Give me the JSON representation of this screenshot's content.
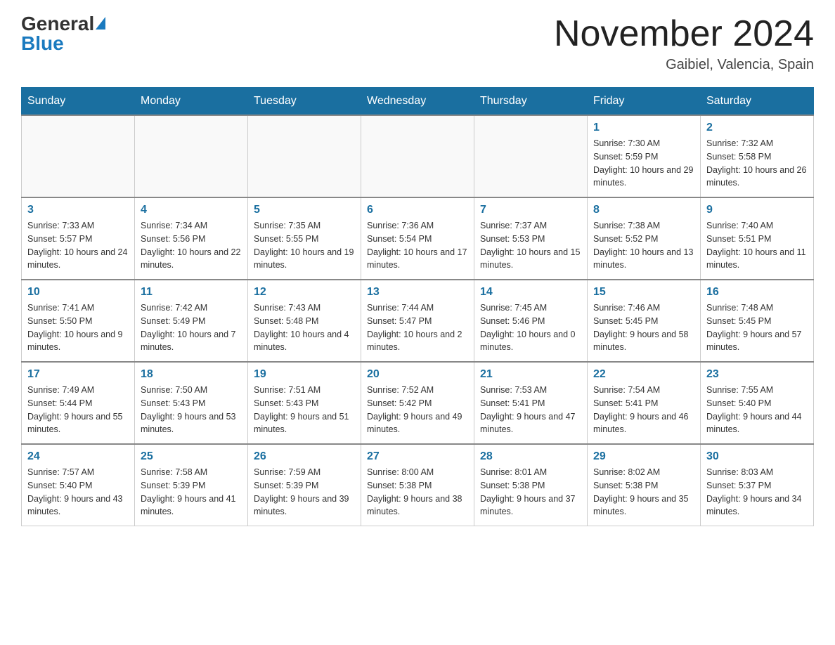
{
  "header": {
    "logo_general": "General",
    "logo_blue": "Blue",
    "month_title": "November 2024",
    "location": "Gaibiel, Valencia, Spain"
  },
  "days_of_week": [
    "Sunday",
    "Monday",
    "Tuesday",
    "Wednesday",
    "Thursday",
    "Friday",
    "Saturday"
  ],
  "weeks": [
    [
      {
        "day": "",
        "info": ""
      },
      {
        "day": "",
        "info": ""
      },
      {
        "day": "",
        "info": ""
      },
      {
        "day": "",
        "info": ""
      },
      {
        "day": "",
        "info": ""
      },
      {
        "day": "1",
        "info": "Sunrise: 7:30 AM\nSunset: 5:59 PM\nDaylight: 10 hours and 29 minutes."
      },
      {
        "day": "2",
        "info": "Sunrise: 7:32 AM\nSunset: 5:58 PM\nDaylight: 10 hours and 26 minutes."
      }
    ],
    [
      {
        "day": "3",
        "info": "Sunrise: 7:33 AM\nSunset: 5:57 PM\nDaylight: 10 hours and 24 minutes."
      },
      {
        "day": "4",
        "info": "Sunrise: 7:34 AM\nSunset: 5:56 PM\nDaylight: 10 hours and 22 minutes."
      },
      {
        "day": "5",
        "info": "Sunrise: 7:35 AM\nSunset: 5:55 PM\nDaylight: 10 hours and 19 minutes."
      },
      {
        "day": "6",
        "info": "Sunrise: 7:36 AM\nSunset: 5:54 PM\nDaylight: 10 hours and 17 minutes."
      },
      {
        "day": "7",
        "info": "Sunrise: 7:37 AM\nSunset: 5:53 PM\nDaylight: 10 hours and 15 minutes."
      },
      {
        "day": "8",
        "info": "Sunrise: 7:38 AM\nSunset: 5:52 PM\nDaylight: 10 hours and 13 minutes."
      },
      {
        "day": "9",
        "info": "Sunrise: 7:40 AM\nSunset: 5:51 PM\nDaylight: 10 hours and 11 minutes."
      }
    ],
    [
      {
        "day": "10",
        "info": "Sunrise: 7:41 AM\nSunset: 5:50 PM\nDaylight: 10 hours and 9 minutes."
      },
      {
        "day": "11",
        "info": "Sunrise: 7:42 AM\nSunset: 5:49 PM\nDaylight: 10 hours and 7 minutes."
      },
      {
        "day": "12",
        "info": "Sunrise: 7:43 AM\nSunset: 5:48 PM\nDaylight: 10 hours and 4 minutes."
      },
      {
        "day": "13",
        "info": "Sunrise: 7:44 AM\nSunset: 5:47 PM\nDaylight: 10 hours and 2 minutes."
      },
      {
        "day": "14",
        "info": "Sunrise: 7:45 AM\nSunset: 5:46 PM\nDaylight: 10 hours and 0 minutes."
      },
      {
        "day": "15",
        "info": "Sunrise: 7:46 AM\nSunset: 5:45 PM\nDaylight: 9 hours and 58 minutes."
      },
      {
        "day": "16",
        "info": "Sunrise: 7:48 AM\nSunset: 5:45 PM\nDaylight: 9 hours and 57 minutes."
      }
    ],
    [
      {
        "day": "17",
        "info": "Sunrise: 7:49 AM\nSunset: 5:44 PM\nDaylight: 9 hours and 55 minutes."
      },
      {
        "day": "18",
        "info": "Sunrise: 7:50 AM\nSunset: 5:43 PM\nDaylight: 9 hours and 53 minutes."
      },
      {
        "day": "19",
        "info": "Sunrise: 7:51 AM\nSunset: 5:43 PM\nDaylight: 9 hours and 51 minutes."
      },
      {
        "day": "20",
        "info": "Sunrise: 7:52 AM\nSunset: 5:42 PM\nDaylight: 9 hours and 49 minutes."
      },
      {
        "day": "21",
        "info": "Sunrise: 7:53 AM\nSunset: 5:41 PM\nDaylight: 9 hours and 47 minutes."
      },
      {
        "day": "22",
        "info": "Sunrise: 7:54 AM\nSunset: 5:41 PM\nDaylight: 9 hours and 46 minutes."
      },
      {
        "day": "23",
        "info": "Sunrise: 7:55 AM\nSunset: 5:40 PM\nDaylight: 9 hours and 44 minutes."
      }
    ],
    [
      {
        "day": "24",
        "info": "Sunrise: 7:57 AM\nSunset: 5:40 PM\nDaylight: 9 hours and 43 minutes."
      },
      {
        "day": "25",
        "info": "Sunrise: 7:58 AM\nSunset: 5:39 PM\nDaylight: 9 hours and 41 minutes."
      },
      {
        "day": "26",
        "info": "Sunrise: 7:59 AM\nSunset: 5:39 PM\nDaylight: 9 hours and 39 minutes."
      },
      {
        "day": "27",
        "info": "Sunrise: 8:00 AM\nSunset: 5:38 PM\nDaylight: 9 hours and 38 minutes."
      },
      {
        "day": "28",
        "info": "Sunrise: 8:01 AM\nSunset: 5:38 PM\nDaylight: 9 hours and 37 minutes."
      },
      {
        "day": "29",
        "info": "Sunrise: 8:02 AM\nSunset: 5:38 PM\nDaylight: 9 hours and 35 minutes."
      },
      {
        "day": "30",
        "info": "Sunrise: 8:03 AM\nSunset: 5:37 PM\nDaylight: 9 hours and 34 minutes."
      }
    ]
  ]
}
